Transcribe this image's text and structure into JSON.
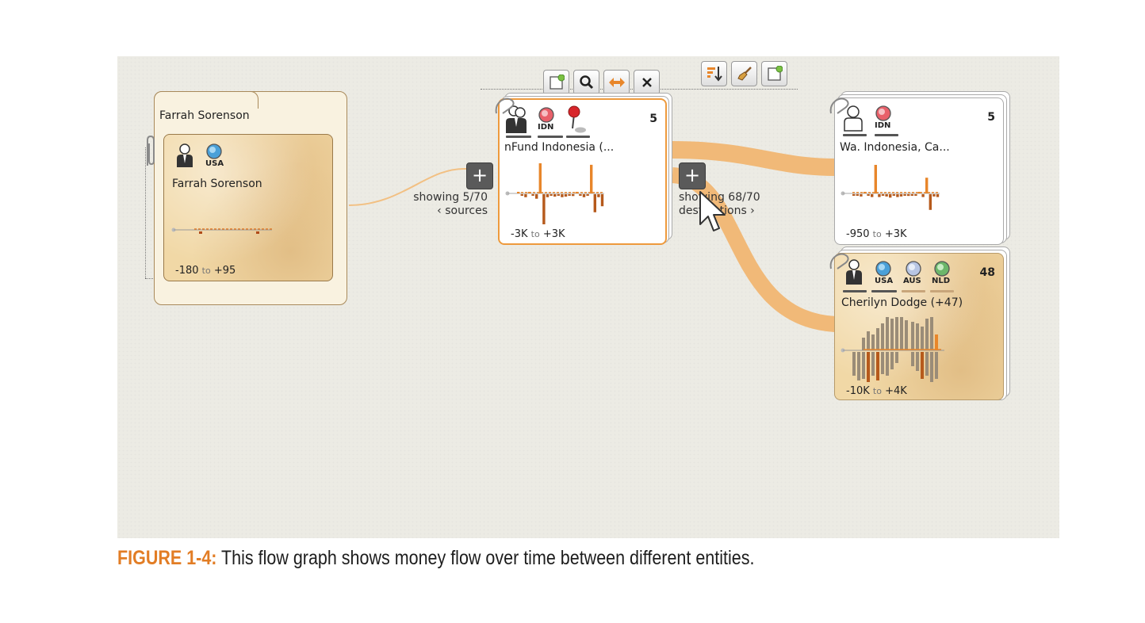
{
  "toolbar_left": [
    {
      "icon": "note-add-icon"
    },
    {
      "icon": "search-icon",
      "glyph": "🔍"
    },
    {
      "icon": "swap-horizontal-icon",
      "glyph": "⇔"
    },
    {
      "icon": "close-icon",
      "glyph": "✕"
    }
  ],
  "toolbar_right": [
    {
      "icon": "sort-descending-icon"
    },
    {
      "icon": "broom-icon"
    },
    {
      "icon": "note-add-icon"
    }
  ],
  "file_folder": {
    "title": "Farrah Sorenson",
    "card": {
      "flag": "USA",
      "name": "Farrah Sorenson",
      "range_min": "-180",
      "range_to": "to",
      "range_max": "+95"
    }
  },
  "selected_card": {
    "count": "5",
    "flag": "IDN",
    "name": "nFund Indonesia (...",
    "range_min": "-3K",
    "range_to": "to",
    "range_max": "+3K",
    "bars": [
      0.05,
      -0.05,
      -0.1,
      0.05,
      -0.05,
      -0.15,
      1.0,
      -1.0,
      -0.1,
      -0.05,
      -0.08,
      -0.05,
      -0.1,
      -0.08,
      -0.05,
      -0.06,
      0.05,
      -0.05,
      -0.1,
      -0.05,
      0.95,
      -0.6,
      -0.1,
      -0.4
    ]
  },
  "sources_control": {
    "line1": "showing 5/70",
    "line2": "‹ sources"
  },
  "destinations_control": {
    "line1": "showing 68/70",
    "line2": "destinations ›"
  },
  "dest_card_1": {
    "count": "5",
    "flag": "IDN",
    "name": "Wa. Indonesia, Ca...",
    "range_min": "-950",
    "range_to": "to",
    "range_max": "+3K",
    "bars": [
      -0.05,
      -0.05,
      -0.08,
      0.05,
      -0.05,
      -0.1,
      1.0,
      -0.1,
      -0.05,
      -0.08,
      -0.12,
      -0.05,
      -0.1,
      -0.08,
      -0.05,
      -0.06,
      -0.05,
      -0.05,
      0.05,
      -0.1,
      0.55,
      -0.55,
      -0.08,
      -0.1
    ]
  },
  "dest_card_2": {
    "count": "48",
    "flags": [
      "USA",
      "AUS",
      "NLD"
    ],
    "name": "Cherilyn Dodge (+47)",
    "range_min": "-10K",
    "range_to": "to",
    "range_max": "+4K"
  },
  "caption": {
    "label": "FIGURE 1-4:",
    "text": " This flow graph shows money flow over time between different entities."
  },
  "colors": {
    "flow": "#f2b46c",
    "selection": "#ee9a3d",
    "canvas": "#ecebe4",
    "caption_label": "#e27d25"
  }
}
